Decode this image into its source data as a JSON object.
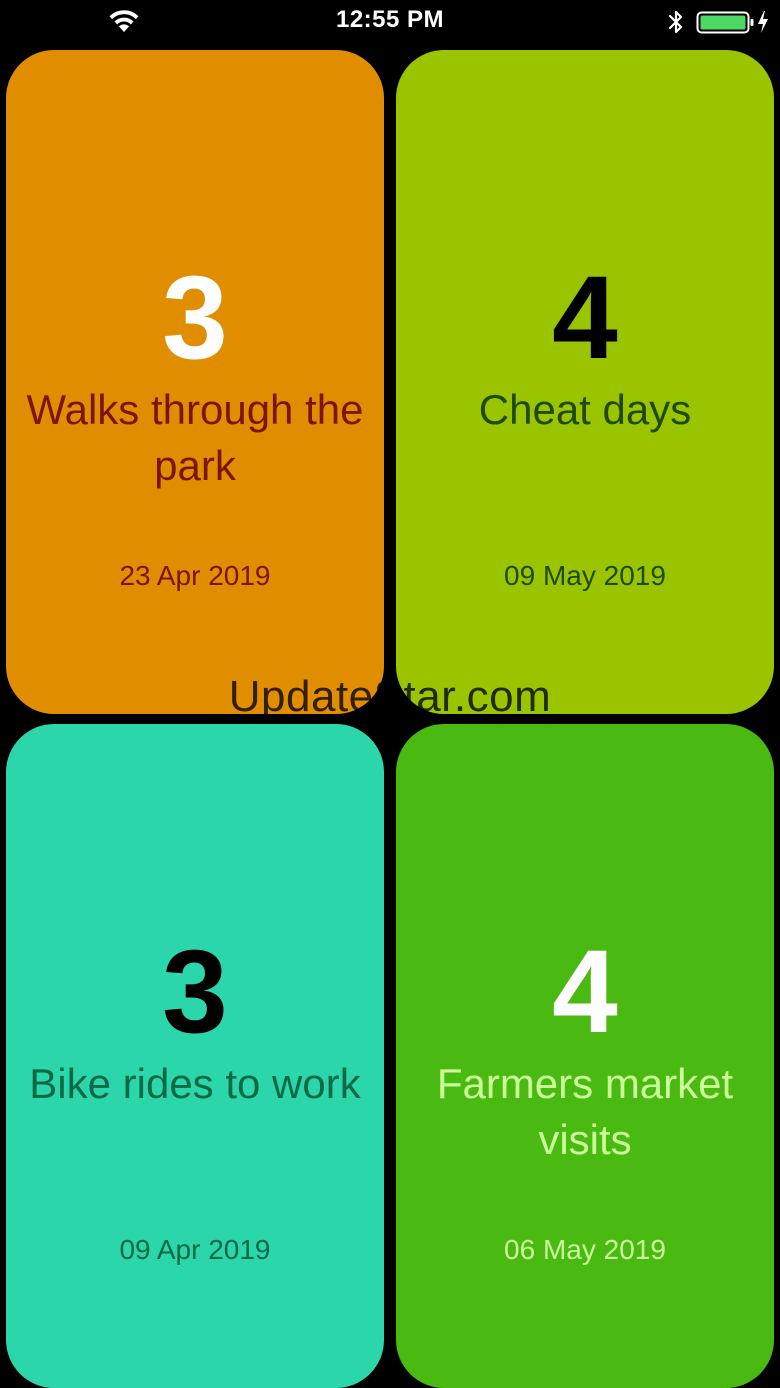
{
  "status_bar": {
    "time": "12:55 PM",
    "icons": [
      "wifi-icon",
      "bluetooth-icon",
      "battery-icon",
      "charging-icon"
    ],
    "battery_color": "#4cd964"
  },
  "cards": [
    {
      "count": "3",
      "title": "Walks through the park",
      "date": "23 Apr 2019",
      "background": "#e08e00",
      "count_color": "#ffffff",
      "text_color": "#7a1500"
    },
    {
      "count": "4",
      "title": "Cheat days",
      "date": "09 May 2019",
      "background": "#9bc400",
      "count_color": "#000000",
      "text_color": "#1f4a0a"
    },
    {
      "count": "3",
      "title": "Bike rides to work",
      "date": "09 Apr 2019",
      "background": "#2bd6aa",
      "count_color": "#000000",
      "text_color": "#0b6a45"
    },
    {
      "count": "4",
      "title": "Farmers market visits",
      "date": "06 May 2019",
      "background": "#4aba12",
      "count_color": "#ffffff",
      "text_color": "#caff9a"
    }
  ],
  "watermark": "UpdateStar.com"
}
